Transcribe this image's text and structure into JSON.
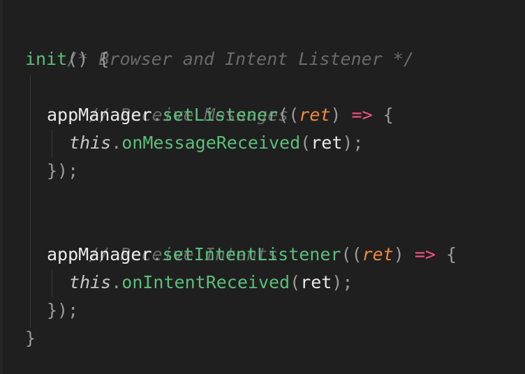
{
  "colors": {
    "background": "#1f1f1f",
    "comment": "#6a6a6a",
    "function": "#5bbf7a",
    "parameter": "#f08a3c",
    "arrow": "#ff4f86"
  },
  "code": {
    "line1": {
      "comment": "/* Browser and Intent Listener */"
    },
    "line2": {
      "fn": "init",
      "parens": "()",
      "brace": " {"
    },
    "line3": {
      "comment": "// Receive Messages"
    },
    "line4": {
      "obj": "appManager",
      "dot": ".",
      "fn": "setListener",
      "open": "((",
      "param": "ret",
      "close": ")",
      "arrow": " =>",
      "brace": " {"
    },
    "line5": {
      "kw": "this",
      "dot": ".",
      "fn": "onMessageReceived",
      "open": "(",
      "arg": "ret",
      "close": ");"
    },
    "line6": {
      "close": "});"
    },
    "line7": {
      "comment": "// Receive Intents"
    },
    "line8": {
      "obj": "appManager",
      "dot": ".",
      "fn": "setIntentListener",
      "open": "((",
      "param": "ret",
      "close": ")",
      "arrow": " =>",
      "brace": " {"
    },
    "line9": {
      "kw": "this",
      "dot": ".",
      "fn": "onIntentReceived",
      "open": "(",
      "arg": "ret",
      "close": ");"
    },
    "line10": {
      "close": "});"
    },
    "line11": {
      "close": "}"
    }
  }
}
